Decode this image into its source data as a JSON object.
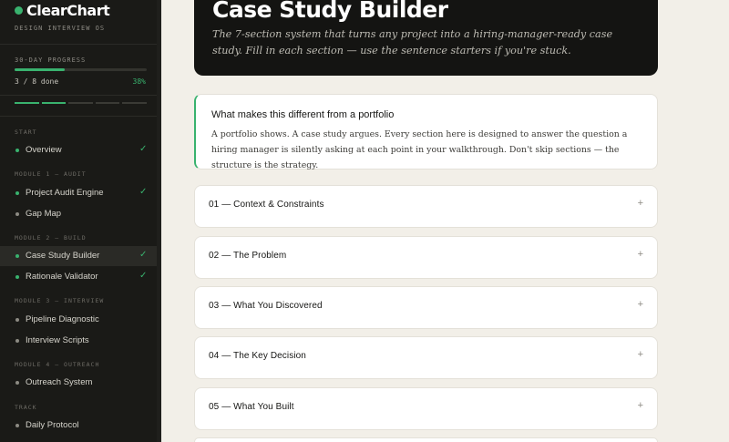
{
  "sidebar": {
    "brand": "ClearChart",
    "subtitle": "DESIGN INTERVIEW OS",
    "progress_label": "30-DAY PROGRESS",
    "progress_done": "3 / 8 done",
    "progress_pct": "38%",
    "progress_value": 0.38,
    "sections": {
      "start": "START",
      "m1": "MODULE 1 — AUDIT",
      "m2": "MODULE 2 — BUILD",
      "m3": "MODULE 3 — INTERVIEW",
      "m4": "MODULE 4 — OUTREACH",
      "track": "TRACK"
    },
    "items": {
      "overview": "Overview",
      "audit_engine": "Project Audit Engine",
      "gap_map": "Gap Map",
      "case_study": "Case Study Builder",
      "rationale": "Rationale Validator",
      "pipeline": "Pipeline Diagnostic",
      "scripts": "Interview Scripts",
      "outreach": "Outreach System",
      "daily": "Daily Protocol"
    },
    "check": "✓"
  },
  "hero": {
    "title": "Case Study Builder",
    "description": "The 7-section system that turns any project into a hiring-manager-ready case study. Fill in each section — use the sentence starters if you're stuck."
  },
  "callout": {
    "title": "What makes this different from a portfolio",
    "body": "A portfolio shows. A case study argues. Every section here is designed to answer the question a hiring manager is silently asking at each point in your walkthrough. Don't skip sections — the structure is the strategy."
  },
  "sections": [
    {
      "label": "01 — Context & Constraints"
    },
    {
      "label": "02 — The Problem"
    },
    {
      "label": "03 — What You Discovered"
    },
    {
      "label": "04 — The Key Decision"
    },
    {
      "label": "05 — What You Built"
    }
  ],
  "plus": "+",
  "colors": {
    "accent": "#39b26e",
    "sidebar_bg": "#1a1a17",
    "page_bg": "#f2efe8"
  }
}
